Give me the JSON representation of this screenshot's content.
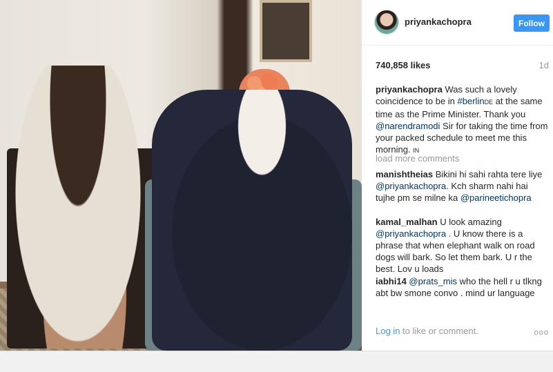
{
  "post": {
    "username": "priyankachopra",
    "follow_label": "Follow",
    "likes": "740,858 likes",
    "age": "1d",
    "caption": {
      "author": "priyankachopra",
      "text_1": " Was such a lovely coincidence to be in ",
      "hashtag": "#berlin",
      "flag": "DE",
      "text_2": " at the same time as the Prime Minister. Thank you ",
      "mention": "@narendramodi",
      "text_3": " Sir for taking the time from your packed schedule to meet me this morning. ",
      "flag2": "IN"
    },
    "load_more": "load more comments",
    "comments": [
      {
        "author": "manishtheias",
        "text": " Bikini hi sahi rahta tere liye ",
        "mention": "@priyankachopra",
        "text2": ". Kch sharm nahi hai tujhe pm se milne ka ",
        "mention2": "@parineetichopra"
      },
      {
        "author": "kamal_malhan",
        "text": " U look amazing ",
        "mention": "@priyankachopra",
        "text2": " . U know there is a phrase that when elephant walk on road dogs will bark. So let them bark. U r the best. Lov u loads"
      },
      {
        "author": "iabhi14",
        "text": " ",
        "mention": "@prats_mis",
        "text2": " who the hell r u tlkng abt bw smone convo . mind ur language"
      }
    ],
    "login_link": "Log in",
    "login_text": " to like or comment.",
    "more_icon": "ooo"
  },
  "icons": {
    "avatar": "avatar",
    "more": "more-options-icon"
  },
  "colors": {
    "follow": "#3897f0",
    "link": "#003569",
    "muted": "#999999"
  }
}
